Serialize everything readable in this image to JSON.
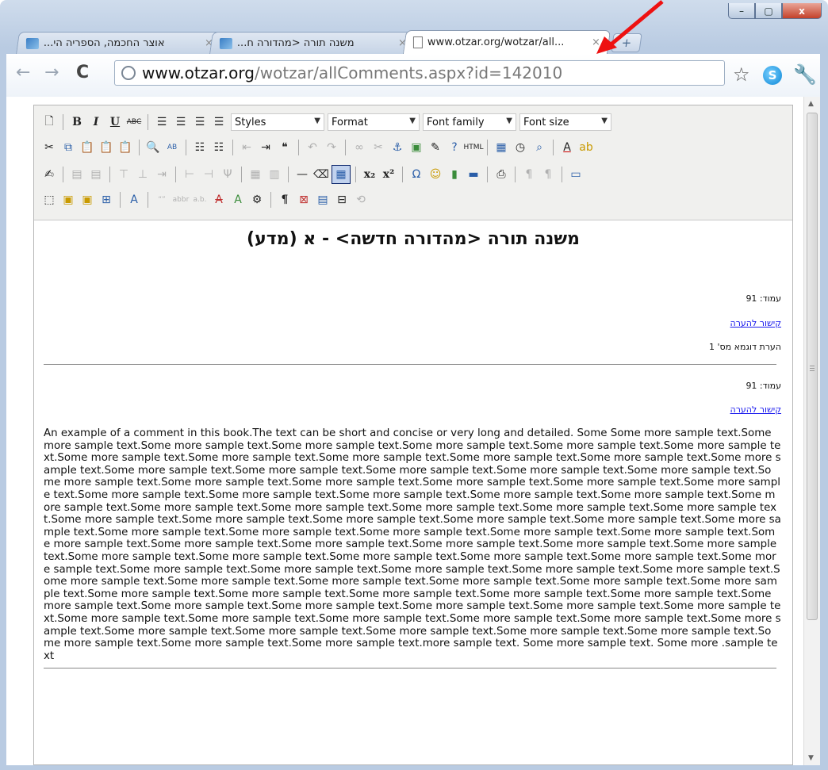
{
  "window": {
    "buttons": {
      "minimize": "–",
      "maximize": "▢",
      "close": "x"
    }
  },
  "tabs": [
    {
      "title": "אוצר החכמה, הספריה הי...",
      "close": "×"
    },
    {
      "title": "משנה תורה <מהדורה ח...",
      "close": "×"
    },
    {
      "title": "www.otzar.org/wotzar/all...",
      "close": "×"
    }
  ],
  "newtab": "+",
  "nav": {
    "back": "←",
    "forward": "→",
    "reload": "C",
    "url_host": "www.otzar.org",
    "url_path": "/wotzar/allComments.aspx?id=142010",
    "star": "☆",
    "skype": "S",
    "wrench": "🔧"
  },
  "toolbar": {
    "styles": "Styles",
    "format": "Format",
    "font_family": "Font family",
    "font_size": "Font size",
    "bold": "B",
    "italic": "I",
    "underline": "U",
    "strike": "ABC",
    "html": "HTML"
  },
  "document": {
    "title": "משנה תורה <מהדורה חדשה> - א (מדע)",
    "entries": [
      {
        "page": "עמוד: 91",
        "link": "קישור להערה",
        "comment": "הערת דוגמא מס' 1"
      },
      {
        "page": "עמוד: 91",
        "link": "קישור להערה"
      }
    ],
    "long_text": "An example of  a comment in this book.The text can be short and concise or very long and detailed. Some  Some more sample text.Some more sample text.Some more sample text.Some more sample text.Some more sample text.Some more sample text.Some more sample text.Some more sample text.Some more sample text.Some more sample text.Some more sample text.Some more sample text.Some more sample text.Some more sample text.Some more sample text.Some more sample text.Some more sample text.Some more sample text.Some more sample text.Some more sample text.Some more sample text.Some more sample text.Some more sample text.Some more sample text.Some more sample text.Some more sample text.Some more sample text.Some more sample text.Some more sample text.Some more sample text.Some more sample text.Some more sample text.Some more sample text.Some more sample text.Some more sample text.Some more sample text.Some more sample text.Some more sample text.Some more sample text.Some more sample text.Some more sample text.Some more sample text.Some more sample text.Some more sample text.Some more sample text.Some more sample text.Some more sample text.Some more sample text.Some more sample text.Some more sample text.Some more sample text.Some more sample text.Some more sample text.Some more sample text.Some more sample text.Some more sample text.Some more sample text.Some more sample text.Some more sample text.Some more sample text.Some more sample text.Some more sample text.Some more sample text.Some more sample text.Some more sample text.Some more sample text.Some more sample text.Some more sample text.Some more sample text.Some more sample text.Some more sample text.Some more sample text.Some more sample text.Some more sample text.Some more sample text.Some more sample text.Some more sample text.Some more sample text.Some more sample text.Some more sample text.Some more sample text.Some more sample text.Some more sample text.Some more sample text.Some more sample text.Some more sample text.Some more sample text.Some more sample text.Some more sample text.Some more sample text.Some more sample text.Some more sample text.Some more sample text.Some more sample text.more sample text. Some more sample text. Some more .sample text"
  }
}
